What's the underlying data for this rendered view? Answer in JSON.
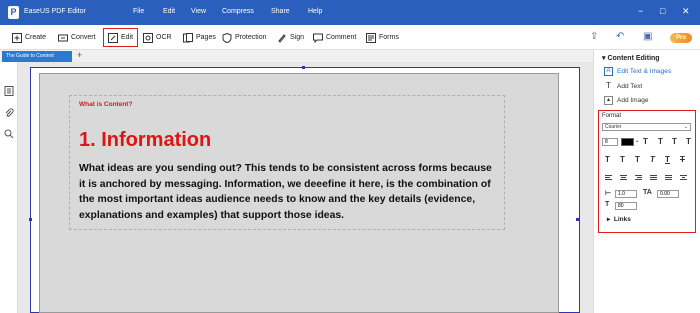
{
  "app": {
    "title": "EaseUS PDF Editor",
    "logo_letter": "P",
    "menu": [
      "File",
      "Edit",
      "View",
      "Compress",
      "Share",
      "Help"
    ],
    "window_controls": [
      "−",
      "□",
      "✕"
    ]
  },
  "toolbar": {
    "create": "Create",
    "convert": "Convert",
    "edit": "Edit",
    "ocr": "OCR",
    "pages": "Pages",
    "protection": "Protection",
    "sign": "Sign",
    "comment": "Comment",
    "forms": "Forms",
    "pro_badge": "Pro"
  },
  "tabs": {
    "doc_tab": "The Guide to Content",
    "add_tab": "+"
  },
  "document": {
    "section_label": "What is Content?",
    "heading": "1. Information",
    "body": "What ideas are you sending out? This tends to be consistent across forms because it is anchored by messaging. Information,  we deeefine it here, is the combination of the most important ideas audience needs to know and the key details (evidence, explanations and examples) that support those ideas."
  },
  "right_panel": {
    "header": "Content Editing",
    "items": [
      {
        "label": "Edit Text & Images",
        "icon": "edit-text-icon"
      },
      {
        "label": "Add Text",
        "icon": "add-text-icon"
      },
      {
        "label": "Add Image",
        "icon": "add-image-icon"
      }
    ],
    "format": {
      "label": "Format",
      "font": "Courier",
      "size": "8",
      "color": "#000000",
      "line_spacing": "1.0",
      "char_spacing": "0.00",
      "scale": "80",
      "links_label": "Links"
    }
  },
  "colors": {
    "titlebar": "#2b5fbd",
    "accent_red": "#e01e1e",
    "heading_red": "#e01414"
  }
}
